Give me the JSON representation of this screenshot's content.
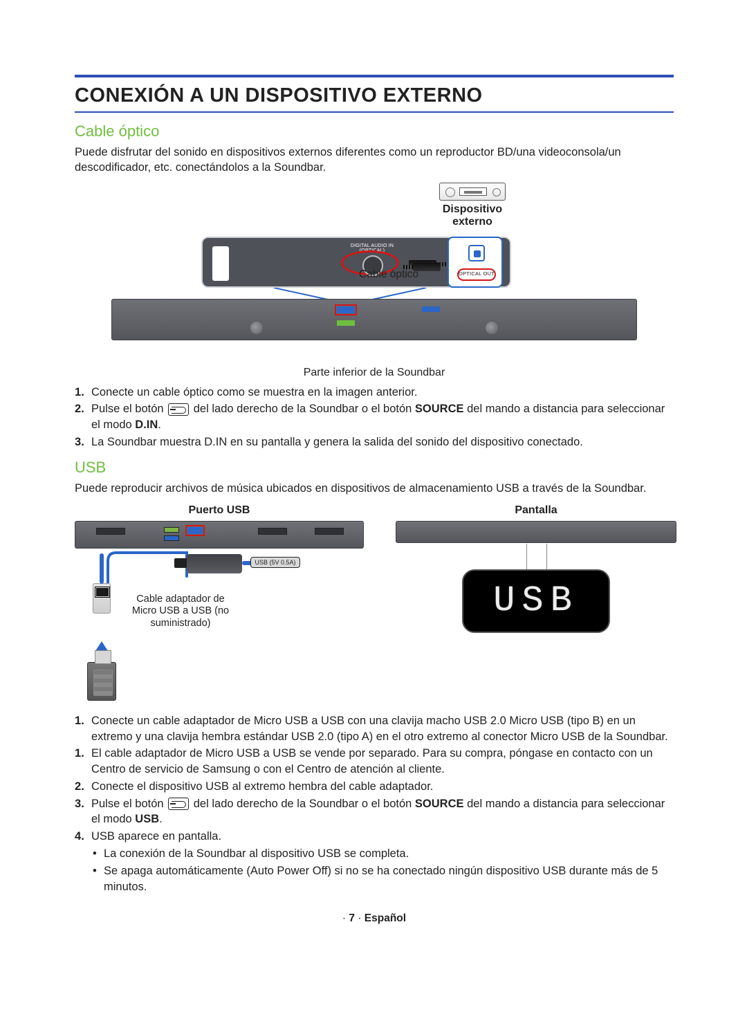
{
  "title": "CONEXIÓN A UN DISPOSITIVO EXTERNO",
  "optical": {
    "heading": "Cable óptico",
    "intro": "Puede disfrutar del sonido en dispositivos externos diferentes como un reproductor BD/una videoconsola/un descodificador, etc. conectándolos a la Soundbar.",
    "fig": {
      "ext_device_label": "Dispositivo\nexterno",
      "port_label": "DIGITAL AUDIO IN\n(OPTICAL)",
      "cable_label": "Cable óptico",
      "optical_out": "OPTICAL OUT",
      "caption": "Parte inferior de la Soundbar"
    },
    "steps": [
      "Conecte un cable óptico como se muestra en la imagen anterior.",
      {
        "pre": "Pulse el botón ",
        "mid": " del lado derecho de la Soundbar o el botón ",
        "src": "SOURCE",
        "post": " del mando a distancia para seleccionar el modo ",
        "mode": "D.IN",
        "end": "."
      },
      "La Soundbar muestra D.IN en su pantalla y genera la salida del sonido del dispositivo conectado."
    ]
  },
  "usb": {
    "heading": "USB",
    "intro": "Puede reproducir archivos de música ubicados en dispositivos de almacenamiento USB a través de la Soundbar.",
    "left_head": "Puerto USB",
    "right_head": "Pantalla",
    "port_badge": "USB (5V 0.5A)",
    "adapter_text": "Cable adaptador de\nMicro USB a USB (no\nsuministrado)",
    "display_text": "USB",
    "steps": {
      "s1": "Conecte un cable adaptador de Micro USB a USB con una clavija macho USB 2.0 Micro USB (tipo B) en un extremo y una clavija hembra estándar USB 2.0 (tipo A) en el otro extremo al conector Micro USB de la Soundbar.",
      "check": "El cable adaptador de Micro USB a USB se vende por separado. Para su compra, póngase en contacto con un Centro de servicio de Samsung o con el Centro de atención al cliente.",
      "s2": "Conecte el dispositivo USB al extremo hembra del cable adaptador.",
      "s3": {
        "pre": "Pulse el botón ",
        "mid": " del lado derecho de la Soundbar o el botón ",
        "src": "SOURCE",
        "post": " del mando a distancia para seleccionar el modo ",
        "mode": "USB",
        "end": "."
      },
      "s4": "USB aparece en pantalla.",
      "b1": "La conexión de la Soundbar al dispositivo USB se completa.",
      "b2": "Se apaga automáticamente (Auto Power Off) si no se ha conectado ningún dispositivo USB durante más de 5 minutos."
    }
  },
  "footer": {
    "page": "7",
    "lang": "Español"
  }
}
